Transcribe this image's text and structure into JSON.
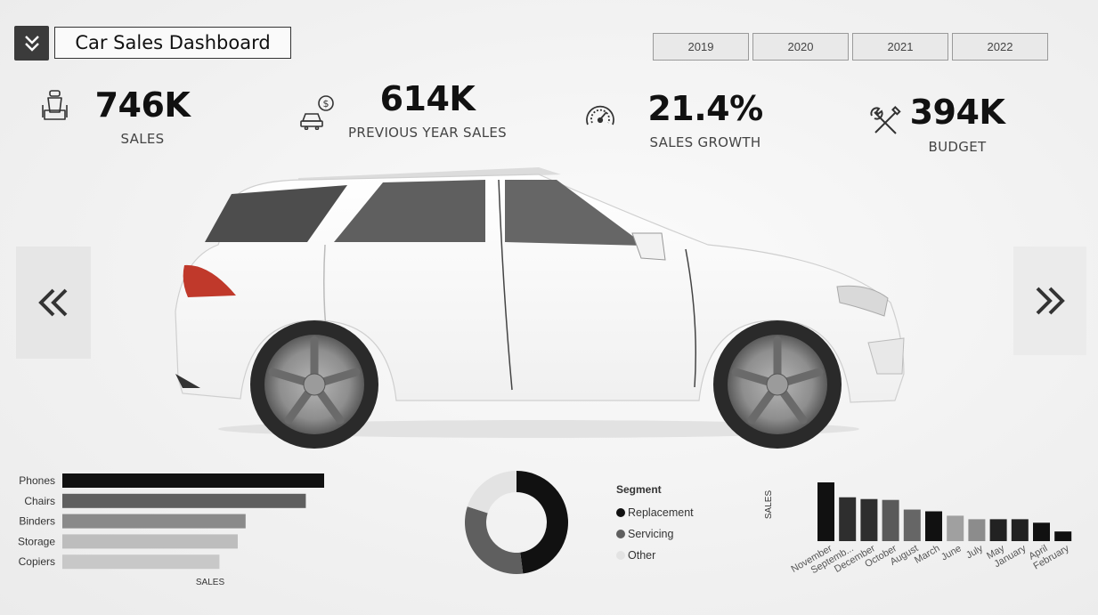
{
  "header": {
    "menu_icon": "double-chevron-down-icon",
    "title": "Car Sales Dashboard"
  },
  "year_filters": [
    "2019",
    "2020",
    "2021",
    "2022"
  ],
  "kpis": {
    "sales": {
      "value": "746K",
      "label": "SALES",
      "icon": "car-seat-icon"
    },
    "previous_year_sales": {
      "value": "614K",
      "label": "PREVIOUS YEAR SALES",
      "icon": "car-dollar-icon"
    },
    "sales_growth": {
      "value": "21.4%",
      "label": "SALES GROWTH",
      "icon": "speedometer-icon"
    },
    "budget": {
      "value": "394K",
      "label": "BUDGET",
      "icon": "tools-icon"
    }
  },
  "navigation": {
    "prev_icon": "double-chevron-left-icon",
    "next_icon": "double-chevron-right-icon"
  },
  "hero_image": "white-suv-car",
  "colors": {
    "black": "#111111",
    "dark_gray": "#5f5f5f",
    "light_gray": "#e3e3e3"
  },
  "chart_data": [
    {
      "type": "bar",
      "orientation": "horizontal",
      "categories": [
        "Phones",
        "Chairs",
        "Binders",
        "Storage",
        "Copiers"
      ],
      "values": [
        100,
        93,
        70,
        67,
        60
      ],
      "colors": [
        "#111111",
        "#5f5f5f",
        "#8a8a8a",
        "#bdbdbd",
        "#c8c8c8"
      ],
      "xlabel": "SALES"
    },
    {
      "type": "pie",
      "donut": true,
      "legend_title": "Segment",
      "labels": [
        "Replacement",
        "Servicing",
        "Other"
      ],
      "values": [
        48,
        32,
        20
      ],
      "colors": [
        "#111111",
        "#5f5f5f",
        "#e3e3e3"
      ]
    },
    {
      "type": "bar",
      "categories": [
        "November",
        "Septemb...",
        "December",
        "October",
        "August",
        "March",
        "June",
        "July",
        "May",
        "January",
        "April",
        "February"
      ],
      "values": [
        67,
        50,
        48,
        47,
        36,
        34,
        29,
        25,
        25,
        25,
        21,
        11
      ],
      "colors": [
        "#111111",
        "#2e2e2e",
        "#2e2e2e",
        "#5a5a5a",
        "#666666",
        "#111111",
        "#a0a0a0",
        "#8c8c8c",
        "#222222",
        "#222222",
        "#111111",
        "#111111"
      ],
      "ylabel": "SALES"
    }
  ]
}
